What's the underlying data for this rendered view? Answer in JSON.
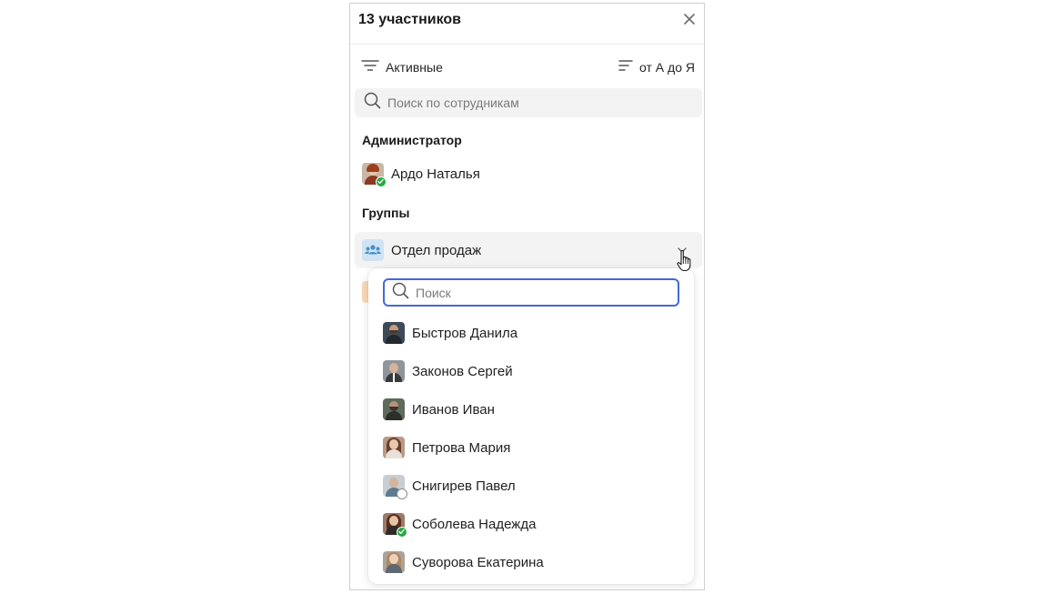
{
  "panel": {
    "title": "13 участников",
    "close_icon": "close-icon"
  },
  "filter": {
    "label": "Активные",
    "icon": "filter-icon"
  },
  "sort": {
    "label": "от А до Я",
    "icon": "sort-icon"
  },
  "search": {
    "placeholder": "Поиск по сотрудникам",
    "value": ""
  },
  "admin_section": {
    "title": "Администратор",
    "member": {
      "name": "Ардо Наталья",
      "status": "online"
    }
  },
  "groups_section": {
    "title": "Группы",
    "group": {
      "name": "Отдел продаж",
      "icon": "users-group-icon",
      "expanded": true
    }
  },
  "dropdown": {
    "search_placeholder": "Поиск",
    "search_value": "",
    "members": [
      {
        "name": "Быстров Данила",
        "status": "none"
      },
      {
        "name": "Законов Сергей",
        "status": "none"
      },
      {
        "name": "Иванов Иван",
        "status": "none"
      },
      {
        "name": "Петрова Мария",
        "status": "none"
      },
      {
        "name": "Снигирев Павел",
        "status": "offline"
      },
      {
        "name": "Соболева Надежда",
        "status": "online"
      },
      {
        "name": "Суворова Екатерина",
        "status": "none"
      }
    ]
  },
  "colors": {
    "accent": "#4468d6",
    "online": "#27a844",
    "row_highlight": "#f3f3f4",
    "group_icon_bg": "#cfe3f3",
    "group_icon_fg": "#4a90c8"
  }
}
